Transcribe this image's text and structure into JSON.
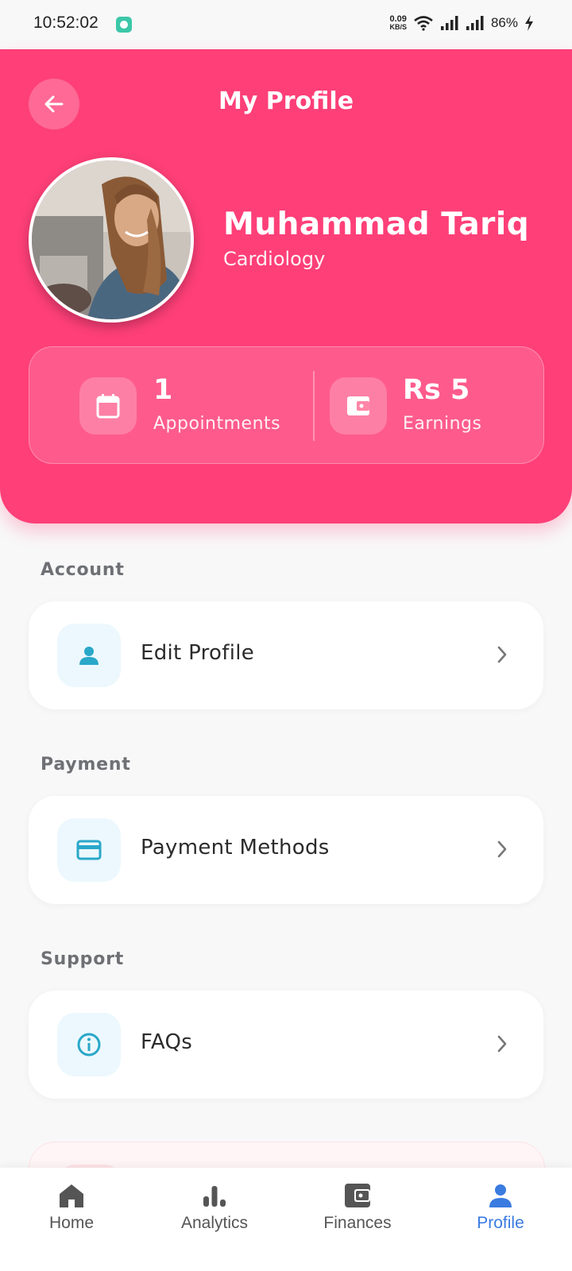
{
  "status_bar": {
    "time": "10:52:02",
    "net_speed_value": "0.09",
    "net_speed_unit": "KB/S",
    "battery": "86%"
  },
  "header": {
    "title": "My Profile",
    "back_icon": "arrow-left-icon"
  },
  "profile": {
    "name": "Muhammad Tariq",
    "specialty": "Cardiology"
  },
  "stats": [
    {
      "value": "1",
      "label": "Appointments",
      "icon": "calendar-icon"
    },
    {
      "value": "Rs 5",
      "label": "Earnings",
      "icon": "wallet-icon"
    }
  ],
  "sections": [
    {
      "title": "Account",
      "item": {
        "label": "Edit Profile",
        "icon": "person-icon"
      }
    },
    {
      "title": "Payment",
      "item": {
        "label": "Payment Methods",
        "icon": "credit-card-icon"
      }
    },
    {
      "title": "Support",
      "item": {
        "label": "FAQs",
        "icon": "info-icon"
      }
    }
  ],
  "bottom_nav": [
    {
      "label": "Home",
      "icon": "home-icon",
      "active": false
    },
    {
      "label": "Analytics",
      "icon": "bar-chart-icon",
      "active": false
    },
    {
      "label": "Finances",
      "icon": "wallet-icon",
      "active": false
    },
    {
      "label": "Profile",
      "icon": "person-icon",
      "active": true
    }
  ],
  "colors": {
    "primary": "#fe3f78",
    "accent_blue": "#3a7be0",
    "icon_teal": "#2aa7c9"
  }
}
